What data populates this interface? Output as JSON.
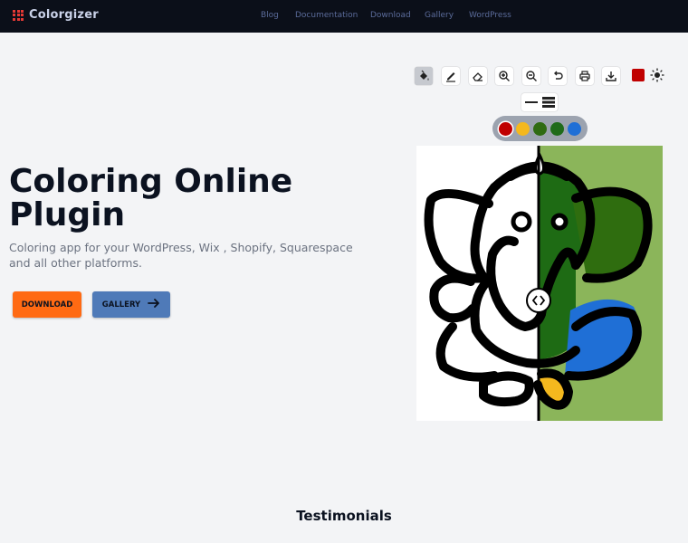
{
  "nav": {
    "logo_text": "Colorgizer",
    "links": [
      "Blog",
      "Documentation",
      "Download",
      "Gallery",
      "WordPress"
    ]
  },
  "hero": {
    "title": "Coloring Online Plugin",
    "subtitle": "Coloring app for your WordPress, Wix , Shopify, Squarespace and all other platforms.",
    "download_label": "DOWNLOAD",
    "gallery_label": "GALLERY"
  },
  "toolbar": {
    "tools": [
      "fill-icon",
      "pencil-icon",
      "eraser-icon",
      "zoom-in-icon",
      "zoom-out-icon",
      "undo-icon",
      "print-icon",
      "download-icon"
    ],
    "selected_color": "#c00000"
  },
  "palette": [
    "#c00000",
    "#f4b81e",
    "#2f6b12",
    "#1f6b1a",
    "#1f6fd6"
  ],
  "colors": {
    "nav_bg": "#0b0f19",
    "download_btn": "#ff6a13",
    "gallery_btn": "#4f7ab8",
    "canvas_right_bg": "#8bb55a",
    "ganesha_green": "#1e6b14",
    "ganesha_blue": "#1f6fd6",
    "ganesha_yellow": "#f4b81e"
  },
  "section": {
    "testimonials": "Testimonials"
  }
}
